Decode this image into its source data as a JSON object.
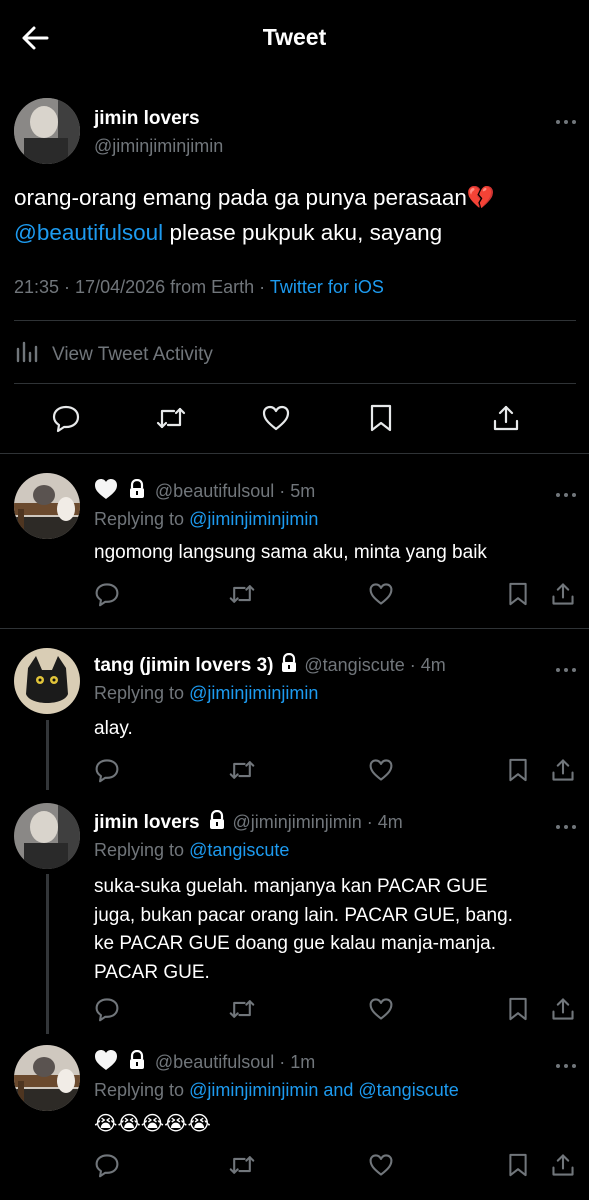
{
  "header": {
    "title": "Tweet"
  },
  "main_tweet": {
    "author_name": "jimin lovers",
    "author_handle": "@jiminjiminjimin",
    "text_line1": "orang-orang emang pada ga punya perasaan",
    "text_emoji": "💔",
    "mention": "@beautifulsoul",
    "text_line2_rest": " please pukpuk aku, sayang",
    "timestamp": "21:35 · 17/04/2026 from Earth ·",
    "client": "Twitter for iOS",
    "activity_label": "View Tweet Activity"
  },
  "replies": [
    {
      "handle_meta": "@beautifulsoul · 5m",
      "replying_prefix": "Replying to",
      "replying_to": "@jiminjiminjimin",
      "text": "ngomong langsung sama aku, minta yang baik"
    },
    {
      "name": "tang (jimin lovers 3)",
      "handle_meta": "@tangiscute · 4m",
      "replying_prefix": "Replying to",
      "replying_to": "@jiminjiminjimin",
      "text": "alay."
    },
    {
      "name": "jimin lovers",
      "handle_meta": "@jiminjiminjimin · 4m",
      "replying_prefix": "Replying to",
      "replying_to": "@tangiscute",
      "text_lines": [
        "suka-suka guelah. manjanya kan PACAR GUE",
        "juga, bukan pacar orang lain. PACAR GUE, bang.",
        "ke PACAR GUE doang gue kalau manja-manja.",
        "PACAR GUE."
      ]
    },
    {
      "handle_meta": "@beautifulsoul · 1m",
      "replying_prefix": "Replying to",
      "replying_to": "@jiminjiminjimin and @tangiscute",
      "text": "😭😭😭😭😭"
    }
  ],
  "colors": {
    "accent": "#1d9bf0",
    "muted": "#71767b",
    "divider": "#2f3336",
    "background": "#000000"
  },
  "icons": [
    "back-arrow-icon",
    "more-dots-icon",
    "reply-icon",
    "retweet-icon",
    "like-icon",
    "bookmark-icon",
    "share-icon",
    "lock-icon",
    "white-heart-icon",
    "analytics-icon",
    "broken-heart-emoji"
  ]
}
